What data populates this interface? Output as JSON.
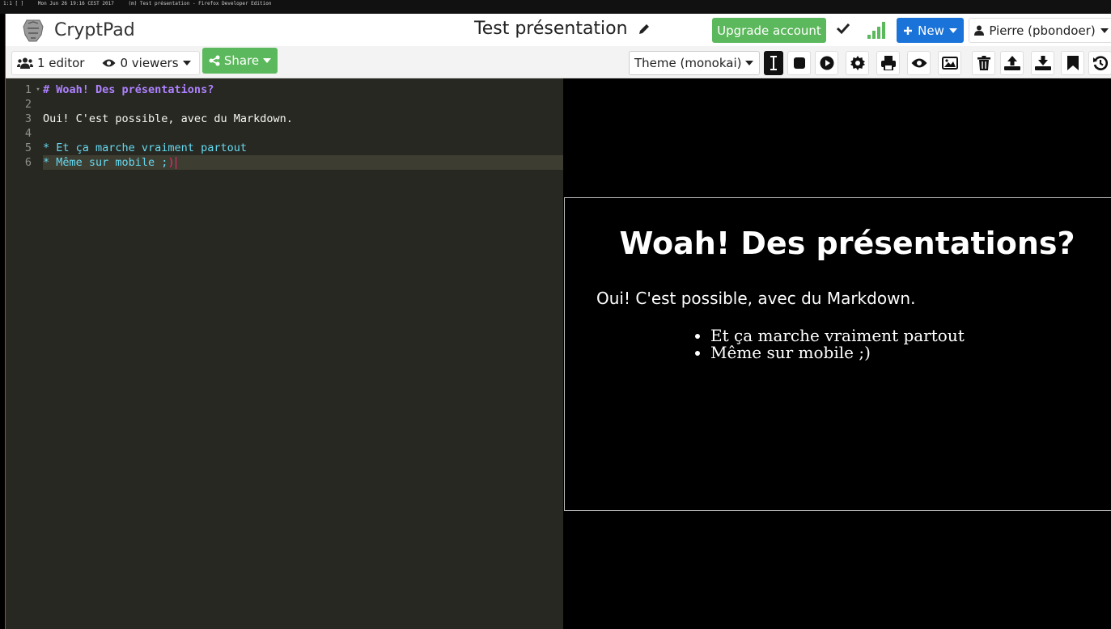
{
  "os_bar": {
    "workspace": "1:1 [ ]",
    "clock": "Mon Jun 26 19:16 CEST 2017",
    "window_title": "(m) Test présentation - Firefox Developer Edition"
  },
  "app": {
    "name": "CryptPad"
  },
  "document": {
    "title": "Test présentation"
  },
  "header": {
    "upgrade_label": "Upgrade account",
    "new_label": "New",
    "user_label": "Pierre (pbondoer)"
  },
  "toolbar": {
    "editors_label": "1 editor",
    "viewers_label": "0 viewers",
    "share_label": "Share",
    "theme_label": "Theme (monokai)"
  },
  "editor": {
    "lines": [
      {
        "number": "1",
        "text": "# Woah! Des présentations?"
      },
      {
        "number": "2",
        "text": ""
      },
      {
        "number": "3",
        "text": "Oui! C'est possible, avec du Markdown."
      },
      {
        "number": "4",
        "text": ""
      },
      {
        "number": "5",
        "text": "* Et ça marche vraiment partout"
      },
      {
        "number": "6",
        "text": "* Même sur mobile ;",
        "trailing": ")"
      }
    ]
  },
  "slide": {
    "title": "Woah! Des présentations?",
    "paragraph": "Oui! C'est possible, avec du Markdown.",
    "bullets": [
      "Et ça marche vraiment partout",
      "Même sur mobile ;)"
    ]
  },
  "colors": {
    "success": "#5cb85c",
    "primary": "#1a73d9",
    "editor_bg": "#272822",
    "heading": "#ae81ff",
    "list": "#66d9ef"
  }
}
